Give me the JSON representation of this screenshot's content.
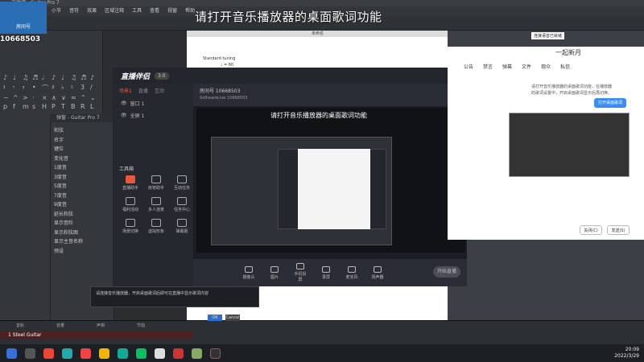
{
  "caption": "请打开音乐播放器的桌面歌词功能",
  "overlay": {
    "badge_label": "房间号",
    "room_number": "10668503"
  },
  "guitar_pro": {
    "window_title": "吉他谱 - Guitar Pro 7",
    "menu": [
      "文件",
      "编辑",
      "轨",
      "小节",
      "音符",
      "效果",
      "区域注释",
      "工具",
      "查看",
      "视窗",
      "帮助"
    ],
    "score_title": "未命名",
    "score_line1": "Standard tuning",
    "score_line2": "♩ = 60",
    "dialog_title": "弹窗 - Guitar Pro 7",
    "dialog_labels": [
      "和弦",
      "名字",
      "键位",
      "变化音",
      "1度音",
      "3度音",
      "5度音",
      "7度音",
      "9度音",
      "延长和弦",
      "显示音阶",
      "显示和弦图",
      "显示主音名称",
      "预设"
    ],
    "track_row": "1 Steel Guitar",
    "track_headers": [
      "音轨",
      "音量",
      "声相",
      "节拍"
    ]
  },
  "live_app": {
    "logo": "直播伴侣",
    "version": "3.0",
    "side_tabs": [
      "场景1",
      "直播",
      "互动"
    ],
    "scenes": [
      "窗口 1",
      "全屏 1"
    ],
    "tools_title": "工具箱",
    "tools": [
      "直播助手",
      "房管助手",
      "互动任务",
      "福利活动",
      "多人连麦",
      "任务中心",
      "场景切换",
      "虚拟形象",
      "弹幕姬"
    ],
    "room_line": "房间号 10668503",
    "room_sub": "SoftwareLive 10668503",
    "preview_caption": "请打开音乐播放器的桌面歌词功能",
    "bottom_tools": [
      "摄像头",
      "图片",
      "手机投屏",
      "录屏",
      "麦克风",
      "扬声器"
    ],
    "start_live": "开始直播"
  },
  "chat": {
    "title": "一起新月",
    "tabs": [
      "公告",
      "禁言",
      "弹幕",
      "文件",
      "观众",
      "私信"
    ],
    "bubble": "请打开音乐播放器的桌面歌词功能，在播放器的歌词设置中，开启桌面歌词显示后再切换。",
    "primary_button": "打开桌面歌词",
    "close_button": "关闭(C)",
    "send_button": "发送(S)",
    "top_info": "连接语音已就绪"
  },
  "notice": {
    "text": "请连接音乐播放器，开启桌面歌词后即可在直播中显示歌词内容",
    "ok": "OK",
    "cancel": "Cancel"
  },
  "clock": {
    "time": "20:09",
    "date": "2022/3/29"
  },
  "colors": {
    "accent": "#e9573f",
    "brand_blue": "#2a6fb5",
    "button_blue": "#3a8df5"
  }
}
